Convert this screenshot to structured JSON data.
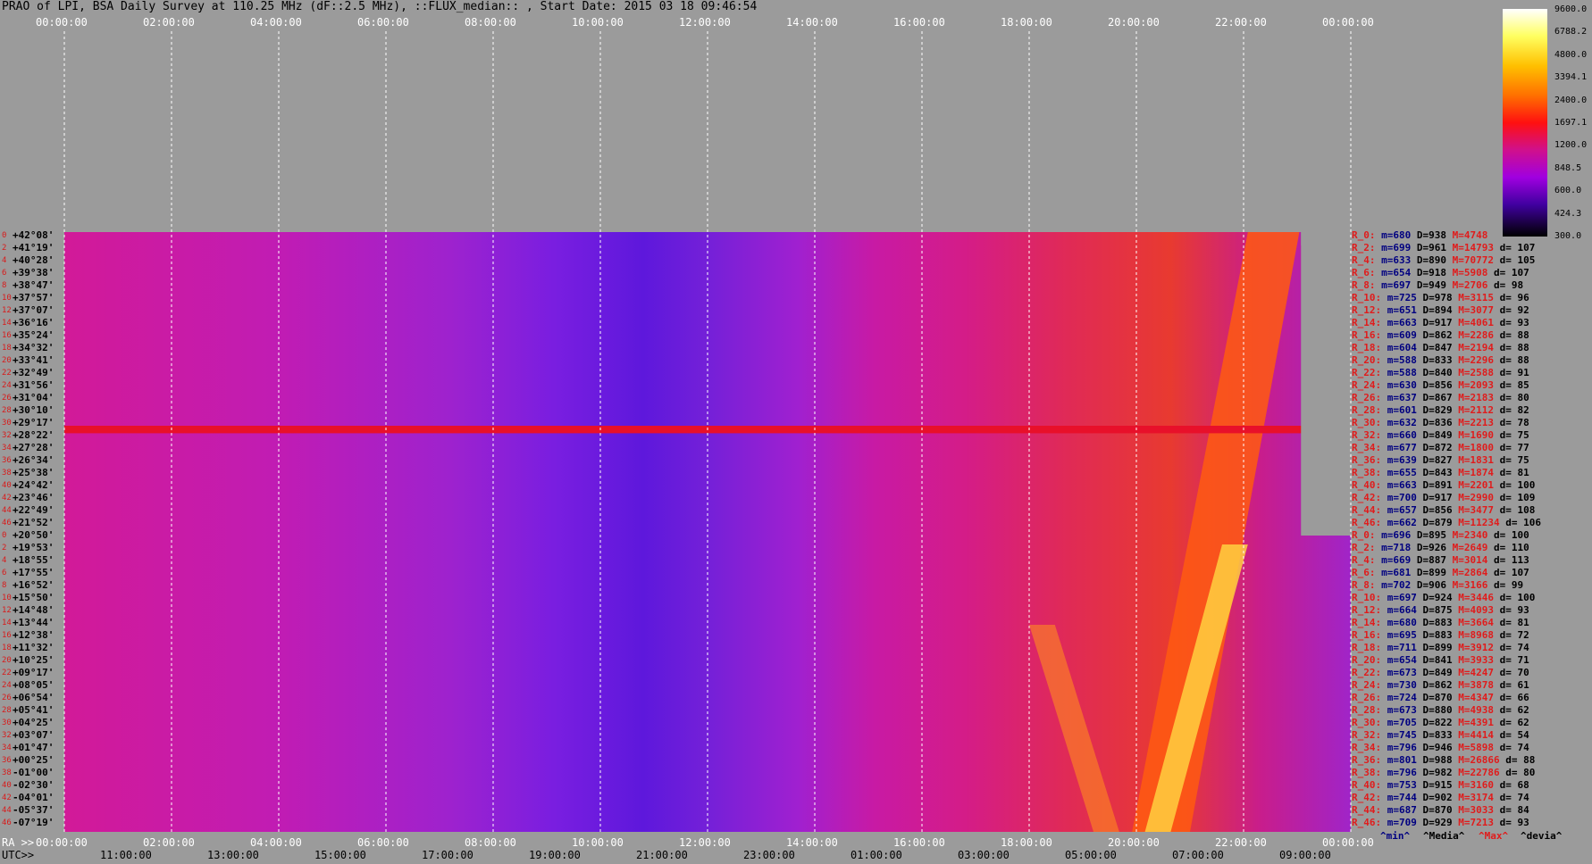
{
  "title": "PRAO of LPI, BSA Daily Survey at 110.25 MHz (dF::2.5 MHz), ::FLUX_median:: , Start Date: 2015 03 18 09:46:54",
  "top_ticks": [
    "00:00:00",
    "02:00:00",
    "04:00:00",
    "06:00:00",
    "08:00:00",
    "10:00:00",
    "12:00:00",
    "14:00:00",
    "16:00:00",
    "18:00:00",
    "20:00:00",
    "22:00:00",
    "00:00:00"
  ],
  "ra_prefix": "RA >>",
  "ra_ticks": [
    "00:00:00",
    "02:00:00",
    "04:00:00",
    "06:00:00",
    "08:00:00",
    "10:00:00",
    "12:00:00",
    "14:00:00",
    "16:00:00",
    "18:00:00",
    "20:00:00",
    "22:00:00",
    "00:00:00"
  ],
  "utc_prefix": "UTC>>",
  "utc_ticks": [
    "11:00:00",
    "13:00:00",
    "15:00:00",
    "17:00:00",
    "19:00:00",
    "21:00:00",
    "23:00:00",
    "01:00:00",
    "03:00:00",
    "05:00:00",
    "07:00:00",
    "09:00:00"
  ],
  "declinations": [
    "+42°08'",
    "+41°19'",
    "+40°28'",
    "+39°38'",
    "+38°47'",
    "+37°57'",
    "+37°07'",
    "+36°16'",
    "+35°24'",
    "+34°32'",
    "+33°41'",
    "+32°49'",
    "+31°56'",
    "+31°04'",
    "+30°10'",
    "+29°17'",
    "+28°22'",
    "+27°28'",
    "+26°34'",
    "+25°38'",
    "+24°42'",
    "+23°46'",
    "+22°49'",
    "+21°52'",
    "+20°50'",
    "+19°53'",
    "+18°55'",
    "+17°55'",
    "+16°52'",
    "+15°50'",
    "+14°48'",
    "+13°44'",
    "+12°38'",
    "+11°32'",
    "+10°25'",
    "+09°17'",
    "+08°05'",
    "+06°54'",
    "+05°41'",
    "+04°25'",
    "+03°07'",
    "+01°47'",
    "+00°25'",
    "-01°00'",
    "-02°30'",
    "-04°01'",
    "-05°37'",
    "-07°19'"
  ],
  "row_indices": [
    "0",
    "2",
    "4",
    "6",
    "8",
    "10",
    "12",
    "14",
    "16",
    "18",
    "20",
    "22",
    "24",
    "26",
    "28",
    "30",
    "32",
    "34",
    "36",
    "38",
    "40",
    "42",
    "44",
    "46",
    "0",
    "2",
    "4",
    "6",
    "8",
    "10",
    "12",
    "14",
    "16",
    "18",
    "20",
    "22",
    "24",
    "26",
    "28",
    "30",
    "32",
    "34",
    "36",
    "38",
    "40",
    "42",
    "44",
    "46"
  ],
  "stats": [
    {
      "r": "R_0:",
      "m": "m=680",
      "D": "D=938",
      "M": "M=4748",
      "d": ""
    },
    {
      "r": "R_2:",
      "m": "m=699",
      "D": "D=961",
      "M": "M=14793",
      "d": "d= 107"
    },
    {
      "r": "R_4:",
      "m": "m=633",
      "D": "D=890",
      "M": "M=70772",
      "d": "d= 105"
    },
    {
      "r": "R_6:",
      "m": "m=654",
      "D": "D=918",
      "M": "M=5908",
      "d": "d= 107"
    },
    {
      "r": "R_8:",
      "m": "m=697",
      "D": "D=949",
      "M": "M=2706",
      "d": "d= 98"
    },
    {
      "r": "R_10:",
      "m": "m=725",
      "D": "D=978",
      "M": "M=3115",
      "d": "d= 96"
    },
    {
      "r": "R_12:",
      "m": "m=651",
      "D": "D=894",
      "M": "M=3077",
      "d": "d= 92"
    },
    {
      "r": "R_14:",
      "m": "m=663",
      "D": "D=917",
      "M": "M=4061",
      "d": "d= 93"
    },
    {
      "r": "R_16:",
      "m": "m=609",
      "D": "D=862",
      "M": "M=2286",
      "d": "d= 88"
    },
    {
      "r": "R_18:",
      "m": "m=604",
      "D": "D=847",
      "M": "M=2194",
      "d": "d= 88"
    },
    {
      "r": "R_20:",
      "m": "m=588",
      "D": "D=833",
      "M": "M=2296",
      "d": "d= 88"
    },
    {
      "r": "R_22:",
      "m": "m=588",
      "D": "D=840",
      "M": "M=2588",
      "d": "d= 91"
    },
    {
      "r": "R_24:",
      "m": "m=630",
      "D": "D=856",
      "M": "M=2093",
      "d": "d= 85"
    },
    {
      "r": "R_26:",
      "m": "m=637",
      "D": "D=867",
      "M": "M=2183",
      "d": "d= 80"
    },
    {
      "r": "R_28:",
      "m": "m=601",
      "D": "D=829",
      "M": "M=2112",
      "d": "d= 82"
    },
    {
      "r": "R_30:",
      "m": "m=632",
      "D": "D=836",
      "M": "M=2213",
      "d": "d= 78"
    },
    {
      "r": "R_32:",
      "m": "m=660",
      "D": "D=849",
      "M": "M=1690",
      "d": "d= 75"
    },
    {
      "r": "R_34:",
      "m": "m=677",
      "D": "D=872",
      "M": "M=1800",
      "d": "d= 77"
    },
    {
      "r": "R_36:",
      "m": "m=639",
      "D": "D=827",
      "M": "M=1831",
      "d": "d= 75"
    },
    {
      "r": "R_38:",
      "m": "m=655",
      "D": "D=843",
      "M": "M=1874",
      "d": "d= 81"
    },
    {
      "r": "R_40:",
      "m": "m=663",
      "D": "D=891",
      "M": "M=2201",
      "d": "d= 100"
    },
    {
      "r": "R_42:",
      "m": "m=700",
      "D": "D=917",
      "M": "M=2990",
      "d": "d= 109"
    },
    {
      "r": "R_44:",
      "m": "m=657",
      "D": "D=856",
      "M": "M=3477",
      "d": "d= 108"
    },
    {
      "r": "R_46:",
      "m": "m=662",
      "D": "D=879",
      "M": "M=11234",
      "d": "d= 106"
    },
    {
      "r": "R_0:",
      "m": "m=696",
      "D": "D=895",
      "M": "M=2340",
      "d": "d= 100"
    },
    {
      "r": "R_2:",
      "m": "m=718",
      "D": "D=926",
      "M": "M=2649",
      "d": "d= 110"
    },
    {
      "r": "R_4:",
      "m": "m=669",
      "D": "D=887",
      "M": "M=3014",
      "d": "d= 113"
    },
    {
      "r": "R_6:",
      "m": "m=681",
      "D": "D=899",
      "M": "M=2864",
      "d": "d= 107"
    },
    {
      "r": "R_8:",
      "m": "m=702",
      "D": "D=906",
      "M": "M=3166",
      "d": "d= 99"
    },
    {
      "r": "R_10:",
      "m": "m=697",
      "D": "D=924",
      "M": "M=3446",
      "d": "d= 100"
    },
    {
      "r": "R_12:",
      "m": "m=664",
      "D": "D=875",
      "M": "M=4093",
      "d": "d= 93"
    },
    {
      "r": "R_14:",
      "m": "m=680",
      "D": "D=883",
      "M": "M=3664",
      "d": "d= 81"
    },
    {
      "r": "R_16:",
      "m": "m=695",
      "D": "D=883",
      "M": "M=8968",
      "d": "d= 72"
    },
    {
      "r": "R_18:",
      "m": "m=711",
      "D": "D=899",
      "M": "M=3912",
      "d": "d= 74"
    },
    {
      "r": "R_20:",
      "m": "m=654",
      "D": "D=841",
      "M": "M=3933",
      "d": "d= 71"
    },
    {
      "r": "R_22:",
      "m": "m=673",
      "D": "D=849",
      "M": "M=4247",
      "d": "d= 70"
    },
    {
      "r": "R_24:",
      "m": "m=730",
      "D": "D=862",
      "M": "M=3878",
      "d": "d= 61"
    },
    {
      "r": "R_26:",
      "m": "m=724",
      "D": "D=870",
      "M": "M=4347",
      "d": "d= 66"
    },
    {
      "r": "R_28:",
      "m": "m=673",
      "D": "D=880",
      "M": "M=4938",
      "d": "d= 62"
    },
    {
      "r": "R_30:",
      "m": "m=705",
      "D": "D=822",
      "M": "M=4391",
      "d": "d= 62"
    },
    {
      "r": "R_32:",
      "m": "m=745",
      "D": "D=833",
      "M": "M=4414",
      "d": "d= 54"
    },
    {
      "r": "R_34:",
      "m": "m=796",
      "D": "D=946",
      "M": "M=5898",
      "d": "d= 74"
    },
    {
      "r": "R_36:",
      "m": "m=801",
      "D": "D=988",
      "M": "M=26866",
      "d": "d= 88"
    },
    {
      "r": "R_38:",
      "m": "m=796",
      "D": "D=982",
      "M": "M=22786",
      "d": "d= 80"
    },
    {
      "r": "R_40:",
      "m": "m=753",
      "D": "D=915",
      "M": "M=3160",
      "d": "d= 68"
    },
    {
      "r": "R_42:",
      "m": "m=744",
      "D": "D=902",
      "M": "M=3174",
      "d": "d= 74"
    },
    {
      "r": "R_44:",
      "m": "m=687",
      "D": "D=870",
      "M": "M=3033",
      "d": "d= 84"
    },
    {
      "r": "R_46:",
      "m": "m=709",
      "D": "D=929",
      "M": "M=7213",
      "d": "d= 93"
    }
  ],
  "footer": {
    "min": "^min^",
    "media": "^Media^",
    "max": "^Max^",
    "devia": "^devia^"
  },
  "colorbar_labels": [
    "9600.0",
    "6788.2",
    "4800.0",
    "3394.1",
    "2400.0",
    "1697.1",
    "1200.0",
    "848.5",
    "600.0",
    "424.3",
    "300.0"
  ],
  "colors": {
    "bg": "#9b9b9b",
    "low": "#3a00a0",
    "mid": "#c000b0",
    "high": "#ff2000",
    "peak": "#ffff80"
  },
  "chart_data": {
    "type": "heatmap",
    "title": "PRAO of LPI, BSA Daily Survey at 110.25 MHz (dF::2.5 MHz), ::FLUX_median:: , Start Date: 2015 03 18 09:46:54",
    "x_axis_ra": [
      "00:00:00",
      "02:00:00",
      "04:00:00",
      "06:00:00",
      "08:00:00",
      "10:00:00",
      "12:00:00",
      "14:00:00",
      "16:00:00",
      "18:00:00",
      "20:00:00",
      "22:00:00",
      "00:00:00"
    ],
    "x_axis_utc": [
      "11:00:00",
      "13:00:00",
      "15:00:00",
      "17:00:00",
      "19:00:00",
      "21:00:00",
      "23:00:00",
      "01:00:00",
      "03:00:00",
      "05:00:00",
      "07:00:00",
      "09:00:00"
    ],
    "y_axis_declination": [
      "+42°08'",
      "-07°19'"
    ],
    "colorscale_range": [
      300.0,
      9600.0
    ],
    "grid": true
  }
}
